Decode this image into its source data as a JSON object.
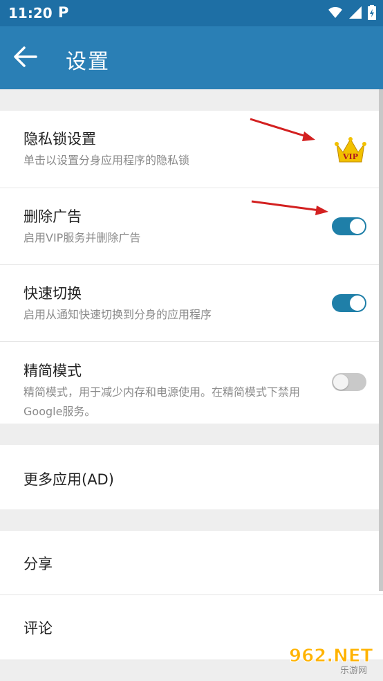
{
  "status_bar": {
    "time": "11:20",
    "app_indicator": "P",
    "icons": [
      "wifi-icon",
      "signal-icon",
      "battery-icon"
    ]
  },
  "app_bar": {
    "title": "设置",
    "back_icon": "arrow-left-icon"
  },
  "settings": {
    "privacy_lock": {
      "title": "隐私锁设置",
      "subtitle": "单击以设置分身应用程序的隐私锁",
      "badge": "VIP"
    },
    "remove_ads": {
      "title": "删除广告",
      "subtitle": "启用VIP服务并删除广告",
      "enabled": true
    },
    "quick_switch": {
      "title": "快速切换",
      "subtitle": "启用从通知快速切换到分身的应用程序",
      "enabled": true
    },
    "lite_mode": {
      "title": "精简模式",
      "subtitle": "精简模式，用于减少内存和电源使用。在精简模式下禁用Google服务。",
      "enabled": false
    },
    "more_apps": {
      "title": "更多应用(AD)"
    },
    "share": {
      "title": "分享"
    },
    "review": {
      "title": "评论"
    }
  },
  "watermark": {
    "text": "962.NET",
    "subtext": "乐游网"
  },
  "colors": {
    "status_bar": "#1e6fa5",
    "app_bar": "#2a7fb5",
    "toggle_on": "#1f7fa8",
    "toggle_off": "#c9c9c9",
    "arrow": "#d32020",
    "crown": "#f2c100"
  }
}
